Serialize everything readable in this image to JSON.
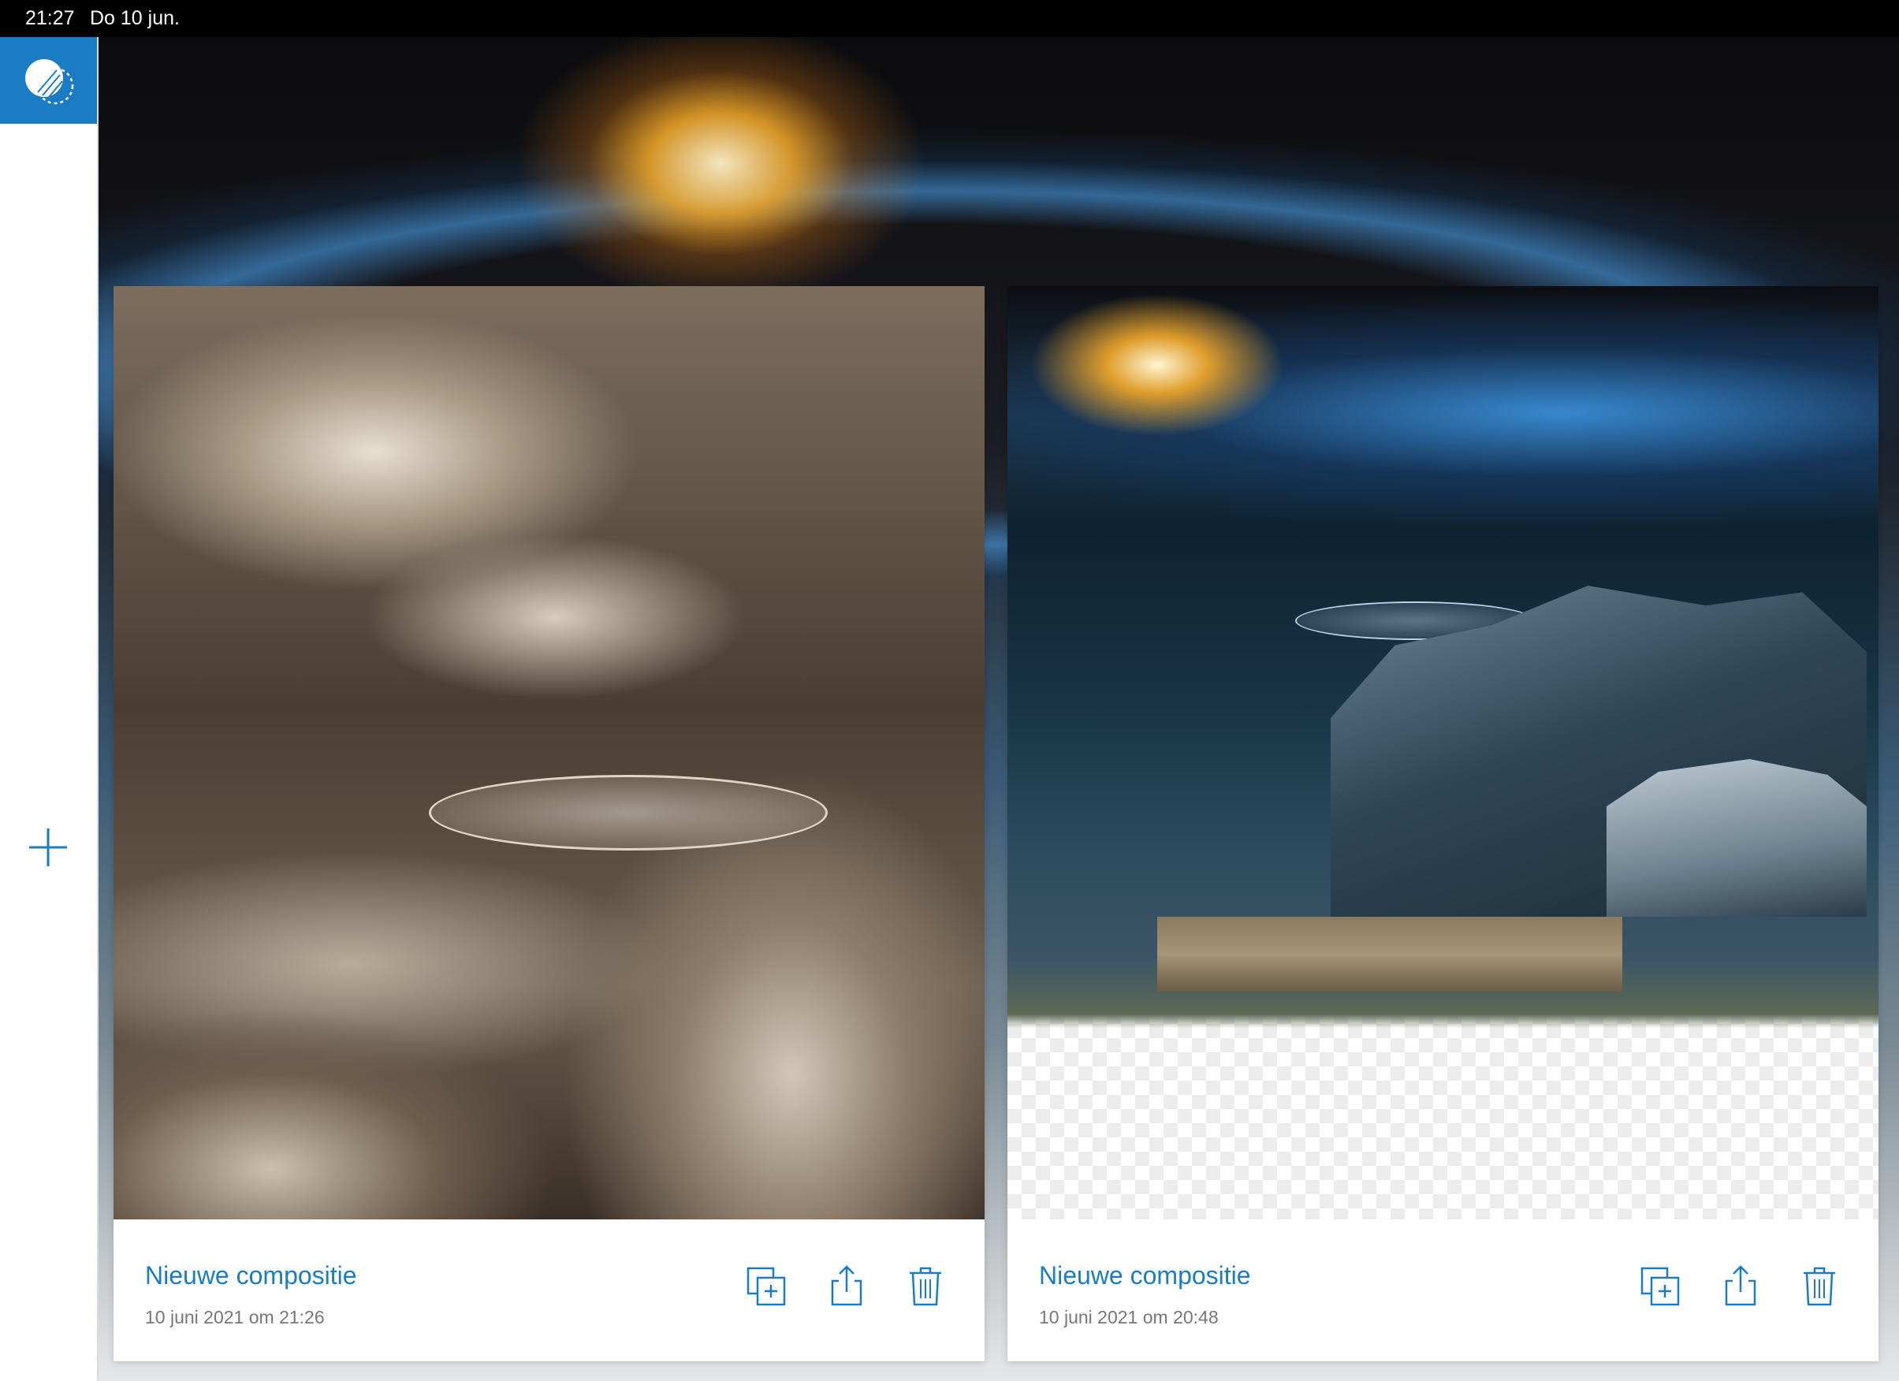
{
  "status_bar": {
    "time": "21:27",
    "date": "Do 10 jun."
  },
  "colors": {
    "accent": "#1a7dc4",
    "sidebar_bg": "#ffffff",
    "status_bar_bg": "#000000"
  },
  "sidebar": {
    "logo_icon": "app-logo-icon",
    "add_icon": "plus-icon"
  },
  "projects": [
    {
      "title": "Nieuwe compositie",
      "date": "10 juni 2021 om 21:26",
      "actions": [
        "duplicate-icon",
        "share-icon",
        "trash-icon"
      ]
    },
    {
      "title": "Nieuwe compositie",
      "date": "10 juni 2021 om 20:48",
      "actions": [
        "duplicate-icon",
        "share-icon",
        "trash-icon"
      ]
    }
  ]
}
